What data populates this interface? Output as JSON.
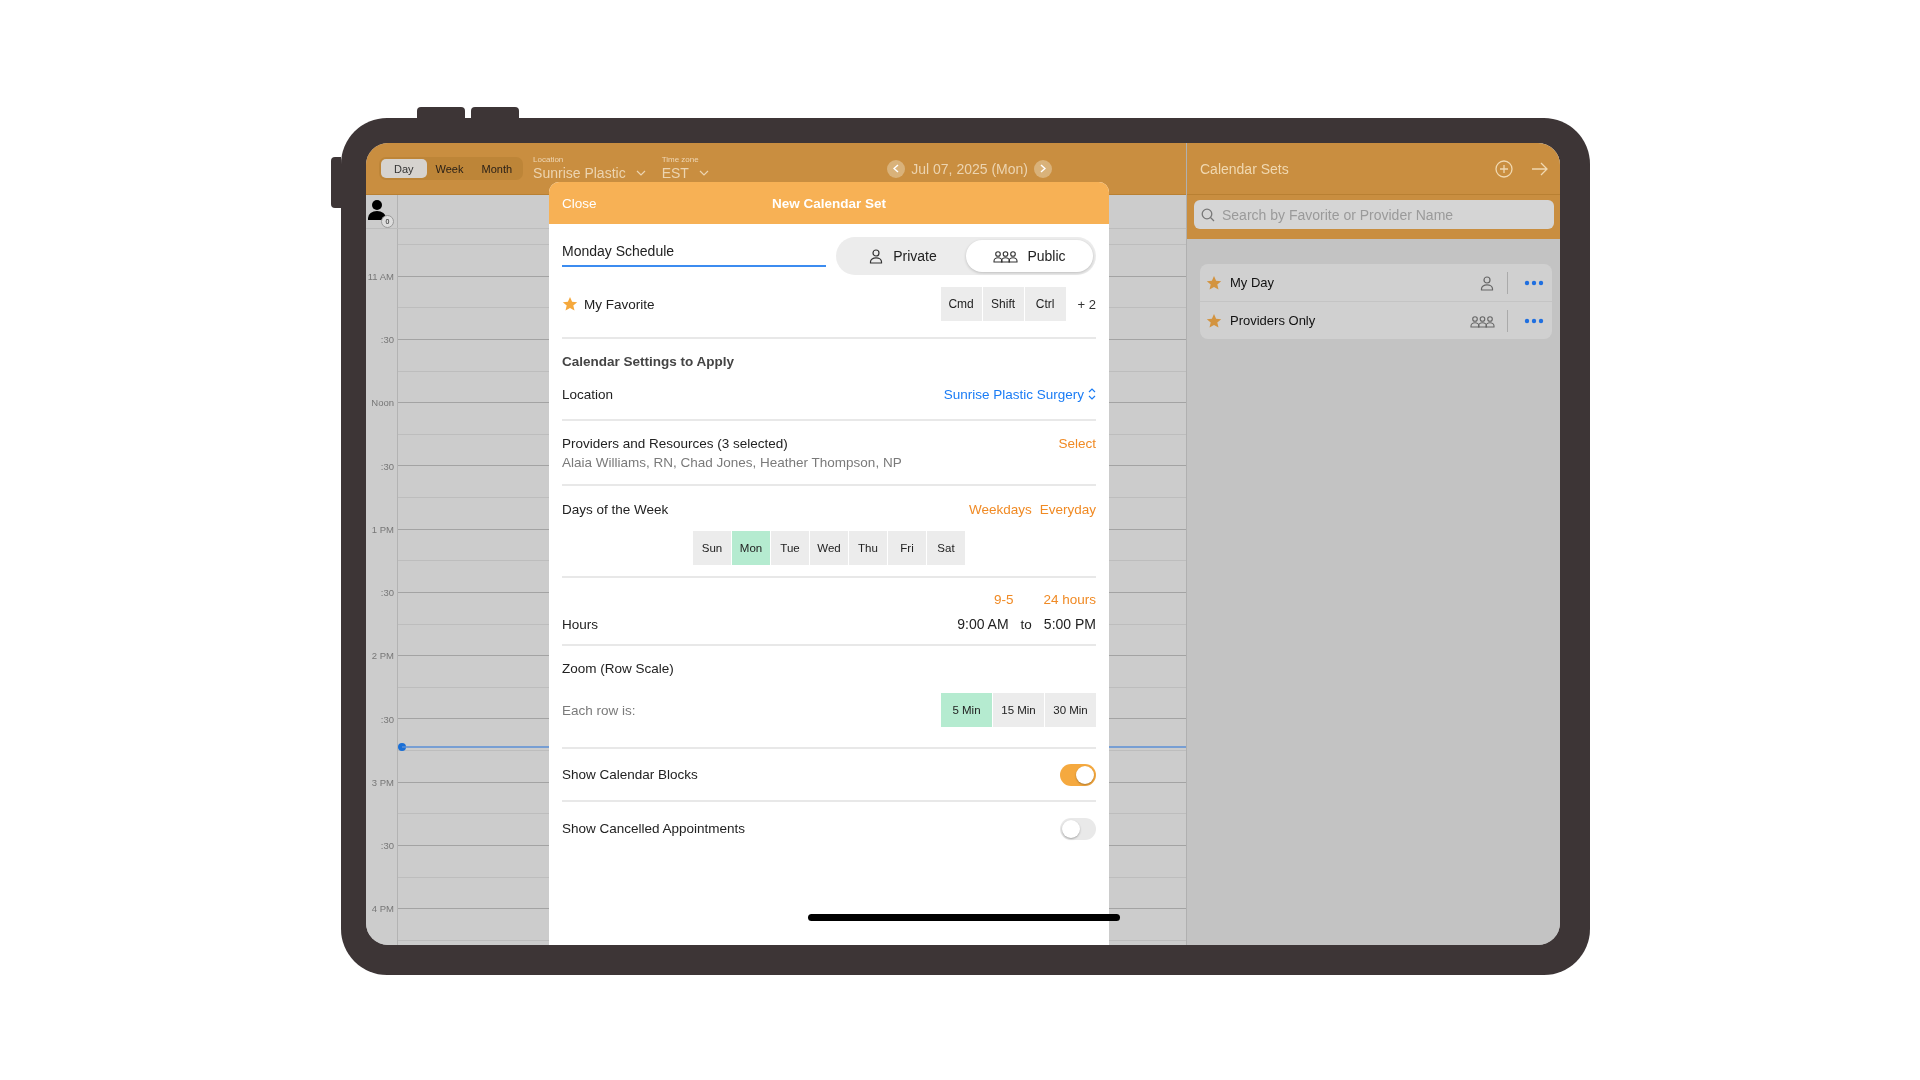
{
  "toolbar": {
    "view_tabs": [
      {
        "label": "Day",
        "selected": true
      },
      {
        "label": "Week",
        "selected": false
      },
      {
        "label": "Month",
        "selected": false
      }
    ],
    "location": {
      "label": "Location",
      "value": "Sunrise Plastic"
    },
    "time_zone": {
      "label": "Time zone",
      "value": "EST"
    },
    "date": "Jul 07, 2025 (Mon)"
  },
  "calendar": {
    "provider_count": "0",
    "time_labels": [
      "11 AM",
      ":30",
      "Noon",
      ":30",
      "1 PM",
      ":30",
      "2 PM",
      ":30",
      "3 PM",
      ":30",
      "4 PM"
    ]
  },
  "calendar_sets": {
    "title": "Calendar Sets",
    "search": {
      "placeholder": "Search by Favorite or Provider Name"
    },
    "items": [
      {
        "name": "My Day",
        "kind": "private"
      },
      {
        "name": "Providers Only",
        "kind": "public"
      }
    ]
  },
  "modal": {
    "close": "Close",
    "title": "New Calendar Set",
    "name_field": {
      "value": "Monday Schedule"
    },
    "visibility": [
      {
        "label": "Private",
        "kind": "private",
        "selected": false
      },
      {
        "label": "Public",
        "kind": "public",
        "selected": true
      }
    ],
    "favorite": {
      "label": "My Favorite",
      "shortcut_keys": [
        "Cmd",
        "Shift",
        "Ctrl"
      ],
      "shortcut_extra": "+ 2"
    },
    "settings_heading": "Calendar Settings to Apply",
    "location": {
      "label": "Location",
      "value": "Sunrise Plastic Surgery"
    },
    "providers": {
      "label": "Providers and Resources (3 selected)",
      "names": "Alaia Williams, RN, Chad Jones, Heather Thompson, NP",
      "action": "Select"
    },
    "days": {
      "label": "Days of the Week",
      "presets": [
        "Weekdays",
        "Everyday"
      ],
      "items": [
        {
          "label": "Sun",
          "selected": false
        },
        {
          "label": "Mon",
          "selected": true
        },
        {
          "label": "Tue",
          "selected": false
        },
        {
          "label": "Wed",
          "selected": false
        },
        {
          "label": "Thu",
          "selected": false
        },
        {
          "label": "Fri",
          "selected": false
        },
        {
          "label": "Sat",
          "selected": false
        }
      ]
    },
    "hours": {
      "label": "Hours",
      "presets": [
        "9-5",
        "24 hours"
      ],
      "from": "9:00 AM",
      "separator": "to",
      "to": "5:00 PM"
    },
    "zoom": {
      "label": "Zoom (Row Scale)",
      "prompt": "Each row is:",
      "options": [
        {
          "label": "5 Min",
          "selected": true
        },
        {
          "label": "15 Min",
          "selected": false
        },
        {
          "label": "30 Min",
          "selected": false
        }
      ]
    },
    "toggles": [
      {
        "label": "Show Calendar Blocks",
        "on": true
      },
      {
        "label": "Show Cancelled Appointments",
        "on": false
      }
    ]
  }
}
